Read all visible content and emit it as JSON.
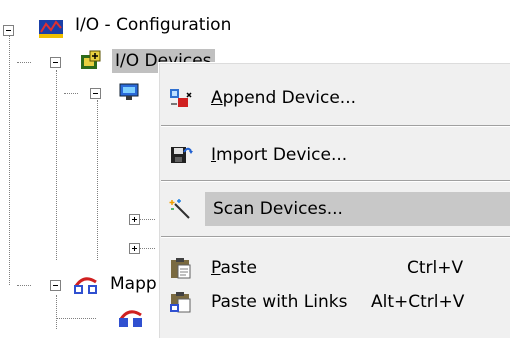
{
  "tree": {
    "root_label": "I/O - Configuration",
    "devices_label": "I/O Devices",
    "mappings_label": "Mapp"
  },
  "menu": {
    "items": [
      {
        "label_pre": "",
        "label_u": "A",
        "label_post": "ppend Device...",
        "shortcut": "",
        "icon": "append-device-icon"
      },
      {
        "label_pre": "",
        "label_u": "I",
        "label_post": "mport Device...",
        "shortcut": "",
        "icon": "import-device-icon"
      },
      {
        "label_pre": "",
        "label_u": "",
        "label_post": "Scan Devices...",
        "shortcut": "",
        "icon": "scan-devices-icon",
        "highlighted": true
      },
      {
        "label_pre": "",
        "label_u": "P",
        "label_post": "aste",
        "shortcut": "Ctrl+V",
        "icon": "paste-icon"
      },
      {
        "label_pre": "",
        "label_u": "",
        "label_post": "Paste with Links",
        "shortcut": "Alt+Ctrl+V",
        "icon": "paste-with-links-icon"
      }
    ]
  },
  "colors": {
    "menu_bg": "#f0f0f0",
    "highlight": "#c8c8c8",
    "selection": "#c0c0c0"
  }
}
